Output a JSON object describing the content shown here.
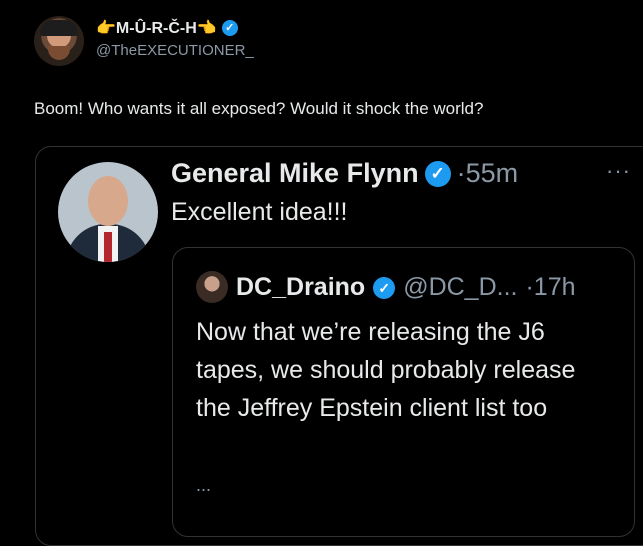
{
  "outer_tweet": {
    "display_name": "👉M-Û-R-Č-H👈",
    "handle": "@TheEXECUTIONER_",
    "text": "Boom! Who wants it all exposed? Would it shock the world?"
  },
  "quoted_tweet": {
    "display_name": "General Mike Flynn",
    "time": "·55m",
    "text": "Excellent idea!!!",
    "more_label": "···"
  },
  "nested_quote": {
    "display_name": "DC_Draino",
    "handle": "@DC_D...",
    "time": "·17h",
    "text": "Now that we’re releasing the J6 tapes, we should probably release the Jeffrey Epstein client list too",
    "ellipsis": "..."
  },
  "colors": {
    "background": "#000000",
    "text": "#e7e9ea",
    "muted": "#8b98a5",
    "verified": "#1d9bf0",
    "border": "#2f3336"
  }
}
